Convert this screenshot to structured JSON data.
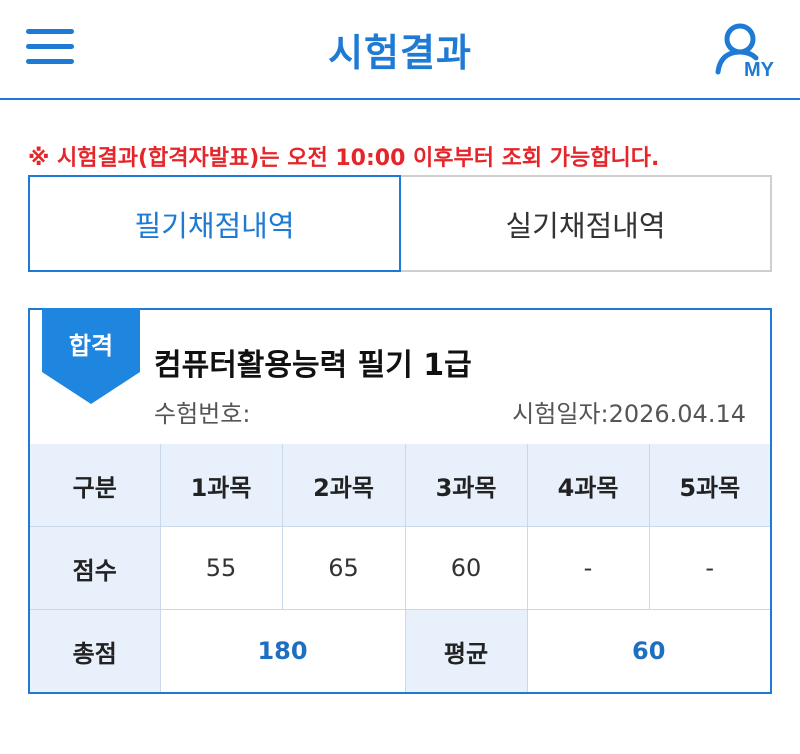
{
  "header": {
    "title": "시험결과",
    "my_label": "MY",
    "accent_color": "#1f7ad4"
  },
  "notice": "※ 시험결과(합격자발표)는 오전 10:00 이후부터 조회 가능합니다.",
  "tabs": [
    {
      "label": "필기채점내역",
      "active": true
    },
    {
      "label": "실기채점내역",
      "active": false
    }
  ],
  "result": {
    "badge": "합격",
    "exam_name": "컴퓨터활용능력 필기 1급",
    "exam_number_label": "수험번호:",
    "exam_date_label": "시험일자:2026.04.14"
  },
  "table": {
    "header_row": [
      "구분",
      "1과목",
      "2과목",
      "3과목",
      "4과목",
      "5과목"
    ],
    "score_row": [
      "점수",
      "55",
      "65",
      "60",
      "-",
      "-"
    ],
    "total_label": "총점",
    "total_value": "180",
    "average_label": "평균",
    "average_value": "60"
  }
}
